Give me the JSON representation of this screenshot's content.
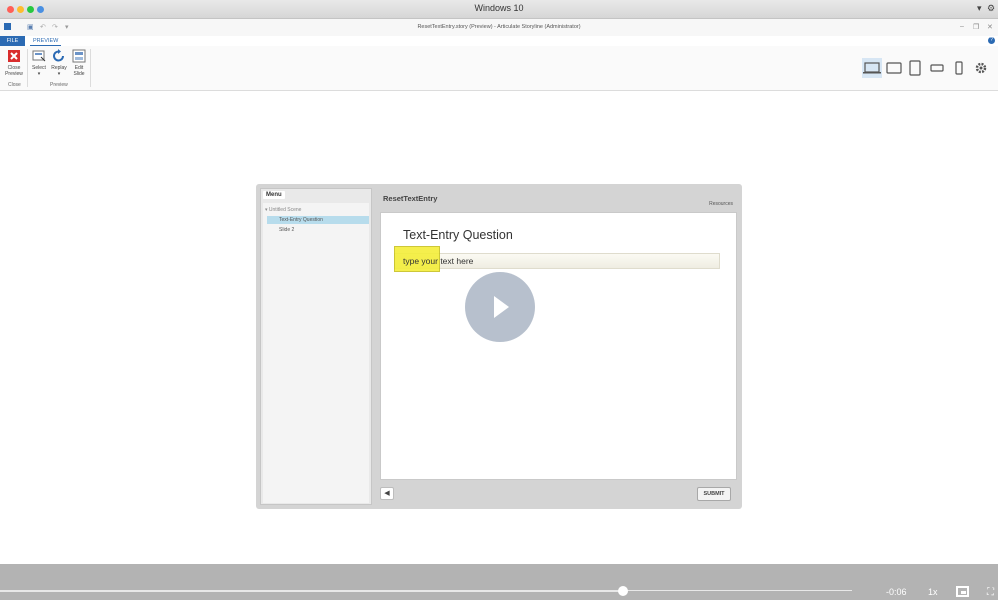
{
  "os": {
    "title": "Windows 10",
    "traffic_colors": [
      "#ff5f57",
      "#febc2e",
      "#28c840",
      "#4a90e2"
    ]
  },
  "app": {
    "title": "ResetTextEntry.story (Preview) - Articulate Storyline (Administrator)",
    "qa_icons": [
      "app-icon",
      "save-icon",
      "undo-icon",
      "redo-icon",
      "customize-icon"
    ]
  },
  "ribbon": {
    "tabs": {
      "file": "FILE",
      "preview": "PREVIEW"
    },
    "help": "?",
    "buttons": {
      "close": [
        "Close",
        "Preview"
      ],
      "select": "Select",
      "replay": "Replay",
      "edit": [
        "Edit",
        "Slide"
      ]
    },
    "groups": {
      "close": "Close",
      "preview": "Preview"
    },
    "devices": [
      "desktop-icon",
      "tablet-landscape-icon",
      "tablet-portrait-icon",
      "phone-landscape-icon",
      "phone-portrait-icon",
      "settings-icon"
    ]
  },
  "player": {
    "menu_tab": "Menu",
    "scene": "Untitled Scene",
    "slides": [
      "Text-Entry Question",
      "Slide 2"
    ],
    "story_title": "ResetTextEntry",
    "resources": "Resources",
    "question_title": "Text-Entry Question",
    "entry_placeholder": "type your text here",
    "submit": "SUBMIT",
    "volume_icon": "speaker-icon"
  },
  "video": {
    "time": "-0:06",
    "speed": "1x",
    "progress": 0.62
  }
}
